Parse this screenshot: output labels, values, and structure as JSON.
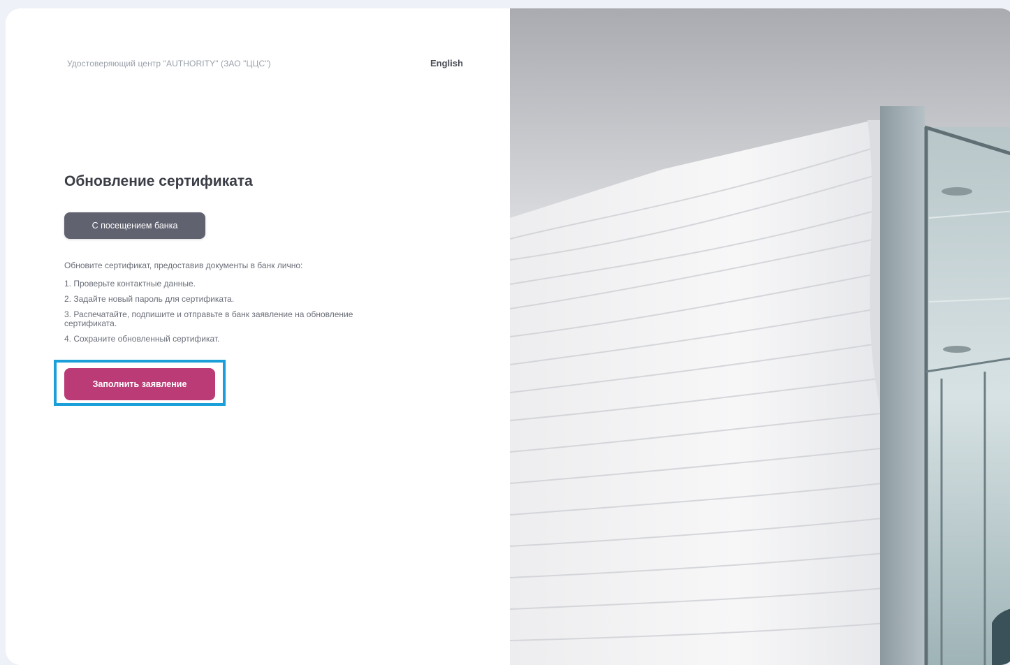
{
  "header": {
    "brand_text": "Удостоверяющий центр \"AUTHORITY\" (ЗАО \"ЦЦС\")",
    "language_link": "English"
  },
  "main": {
    "title": "Обновление сертификата",
    "mode_button_label": "С посещением банка",
    "intro_text": "Обновите сертификат, предоставив документы в банк лично:",
    "steps": [
      "1. Проверьте контактные данные.",
      "2. Задайте новый пароль для сертификата.",
      "3. Распечатайте, подпишите и отправьте в банк заявление на обновление сертификата.",
      "4. Сохраните обновленный сертификат."
    ],
    "primary_button_label": "Заполнить заявление"
  },
  "colors": {
    "page_background": "#eef1f7",
    "mode_button": "#60626f",
    "primary_button": "#bb3b76",
    "highlight": "#1a9fd8"
  },
  "decor": {
    "photo": "interior-wavy-wall-image"
  }
}
